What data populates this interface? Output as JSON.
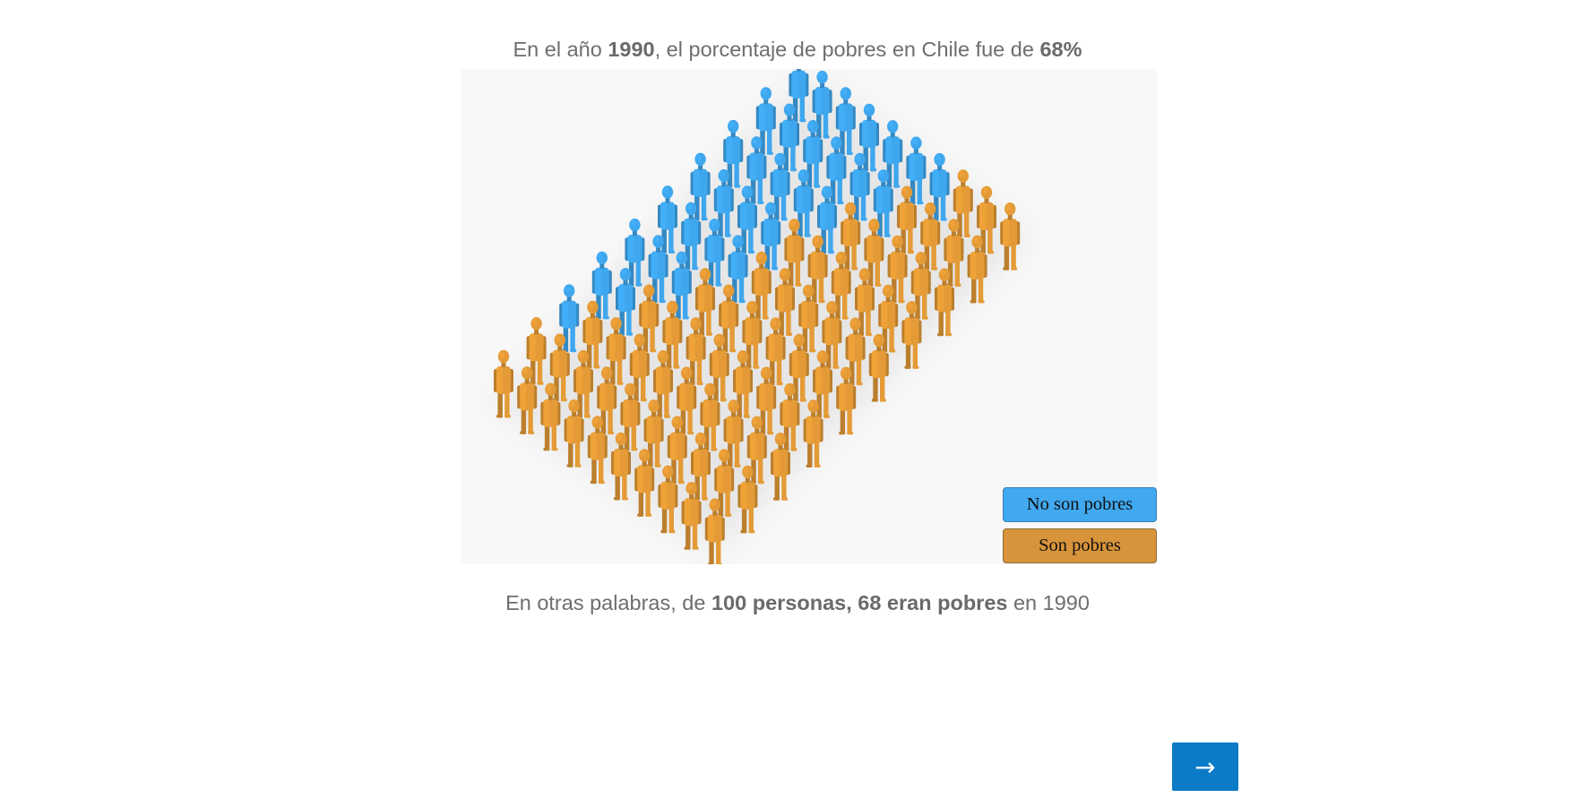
{
  "headline": {
    "prefix": "En el año ",
    "year": "1990",
    "middle": ", el porcentaje de pobres en Chile fue de ",
    "percent": "68%"
  },
  "chart_data": {
    "type": "pictogram",
    "total": 100,
    "grid": [
      10,
      10
    ],
    "series": [
      {
        "name": "No son pobres",
        "value": 32,
        "color": "#3fa7ee"
      },
      {
        "name": "Son pobres",
        "value": 68,
        "color": "#e49b37"
      }
    ]
  },
  "legend": {
    "not_poor": "No son pobres",
    "poor": "Son pobres"
  },
  "caption": {
    "prefix": "En otras palabras, de ",
    "emphasis": "100 personas, 68 eran pobres",
    "suffix": " en 1990"
  },
  "next_button": {
    "icon": "arrow-right-icon",
    "label": "→"
  }
}
